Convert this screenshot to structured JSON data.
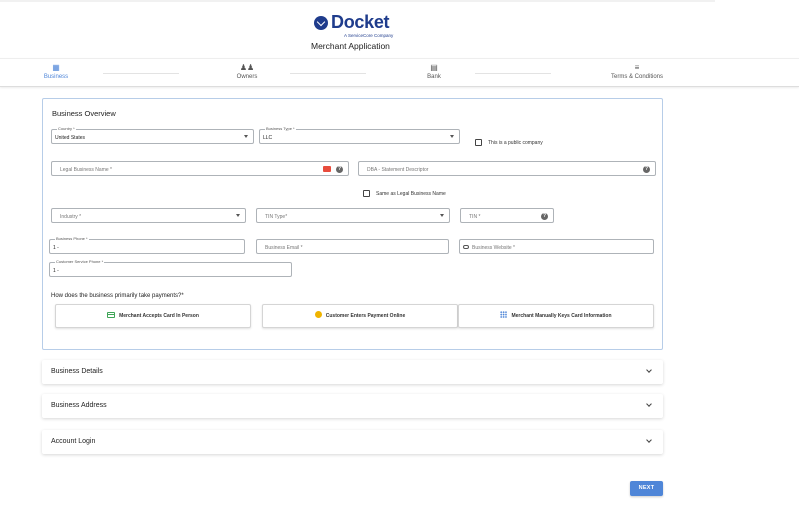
{
  "brand": {
    "logo_text": "Docket",
    "subtitle": "A ServiceCore Company",
    "app_title": "Merchant Application",
    "color": "#1f3c8c"
  },
  "steps": [
    {
      "label": "Business",
      "icon": "building-icon",
      "active": true
    },
    {
      "label": "Owners",
      "icon": "people-icon",
      "active": false
    },
    {
      "label": "Bank",
      "icon": "bank-icon",
      "active": false
    },
    {
      "label": "Terms & Conditions",
      "icon": "edit-list-icon",
      "active": false
    }
  ],
  "overview": {
    "title": "Business Overview",
    "country": {
      "label": "Country *",
      "value": "United States"
    },
    "business_type": {
      "label": "Business Type *",
      "value": "LLC"
    },
    "public_company_label": "This is a public company",
    "legal_name": {
      "placeholder": "Legal Business Name *"
    },
    "dba": {
      "placeholder": "DBA - Statement Descriptor"
    },
    "same_as_legal_label": "Same as Legal Business Name",
    "industry": {
      "placeholder": "Industry *"
    },
    "tin_type": {
      "placeholder": "TIN Type*"
    },
    "tin": {
      "placeholder": "TIN *"
    },
    "business_phone": {
      "label": "Business Phone *",
      "value": "1 -"
    },
    "business_email": {
      "placeholder": "Business Email *"
    },
    "business_website": {
      "placeholder": "Business Website *"
    },
    "customer_phone": {
      "label": "Customer Service Phone *",
      "value": "1 -"
    },
    "payment_question": "How does the business primarily take payments?*",
    "payment_options": [
      {
        "label": "Merchant Accepts Card In Person",
        "icon": "credit-card-icon"
      },
      {
        "label": "Customer Enters Payment Online",
        "icon": "globe-icon"
      },
      {
        "label": "Merchant Manually Keys Card Information",
        "icon": "keypad-icon"
      }
    ]
  },
  "sections": [
    {
      "title": "Business Details"
    },
    {
      "title": "Business Address"
    },
    {
      "title": "Account Login"
    }
  ],
  "next_label": "NEXT",
  "accent_color": "#4f86d8"
}
